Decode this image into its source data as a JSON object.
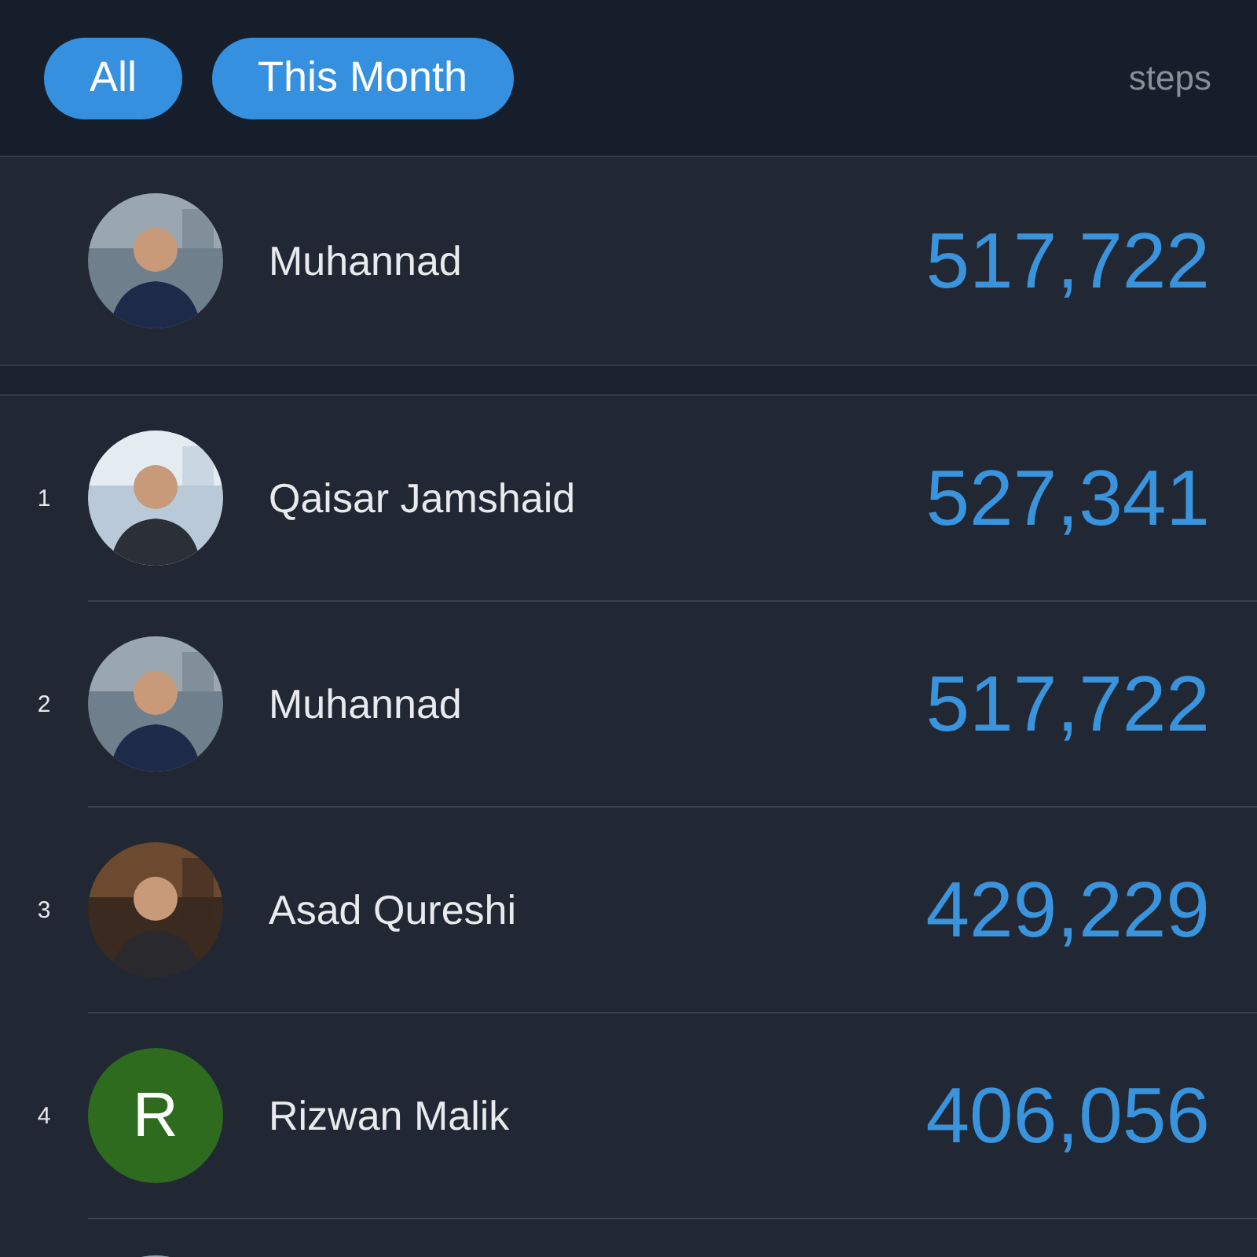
{
  "filters": [
    {
      "label": "All"
    },
    {
      "label": "This Month"
    }
  ],
  "unit_label": "steps",
  "current_user": {
    "name": "Muhannad",
    "steps": "517,722",
    "avatar": {
      "kind": "picture"
    }
  },
  "ranking": [
    {
      "rank": "1",
      "name": "Qaisar Jamshaid",
      "steps": "527,341",
      "avatar": {
        "kind": "picture"
      }
    },
    {
      "rank": "2",
      "name": "Muhannad",
      "steps": "517,722",
      "avatar": {
        "kind": "picture"
      }
    },
    {
      "rank": "3",
      "name": "Asad Qureshi",
      "steps": "429,229",
      "avatar": {
        "kind": "picture"
      }
    },
    {
      "rank": "4",
      "name": "Rizwan Malik",
      "steps": "406,056",
      "avatar": {
        "kind": "initial",
        "initial": "R",
        "color": "#2e6b1f"
      }
    },
    {
      "avatar": {
        "kind": "picture"
      }
    }
  ]
}
